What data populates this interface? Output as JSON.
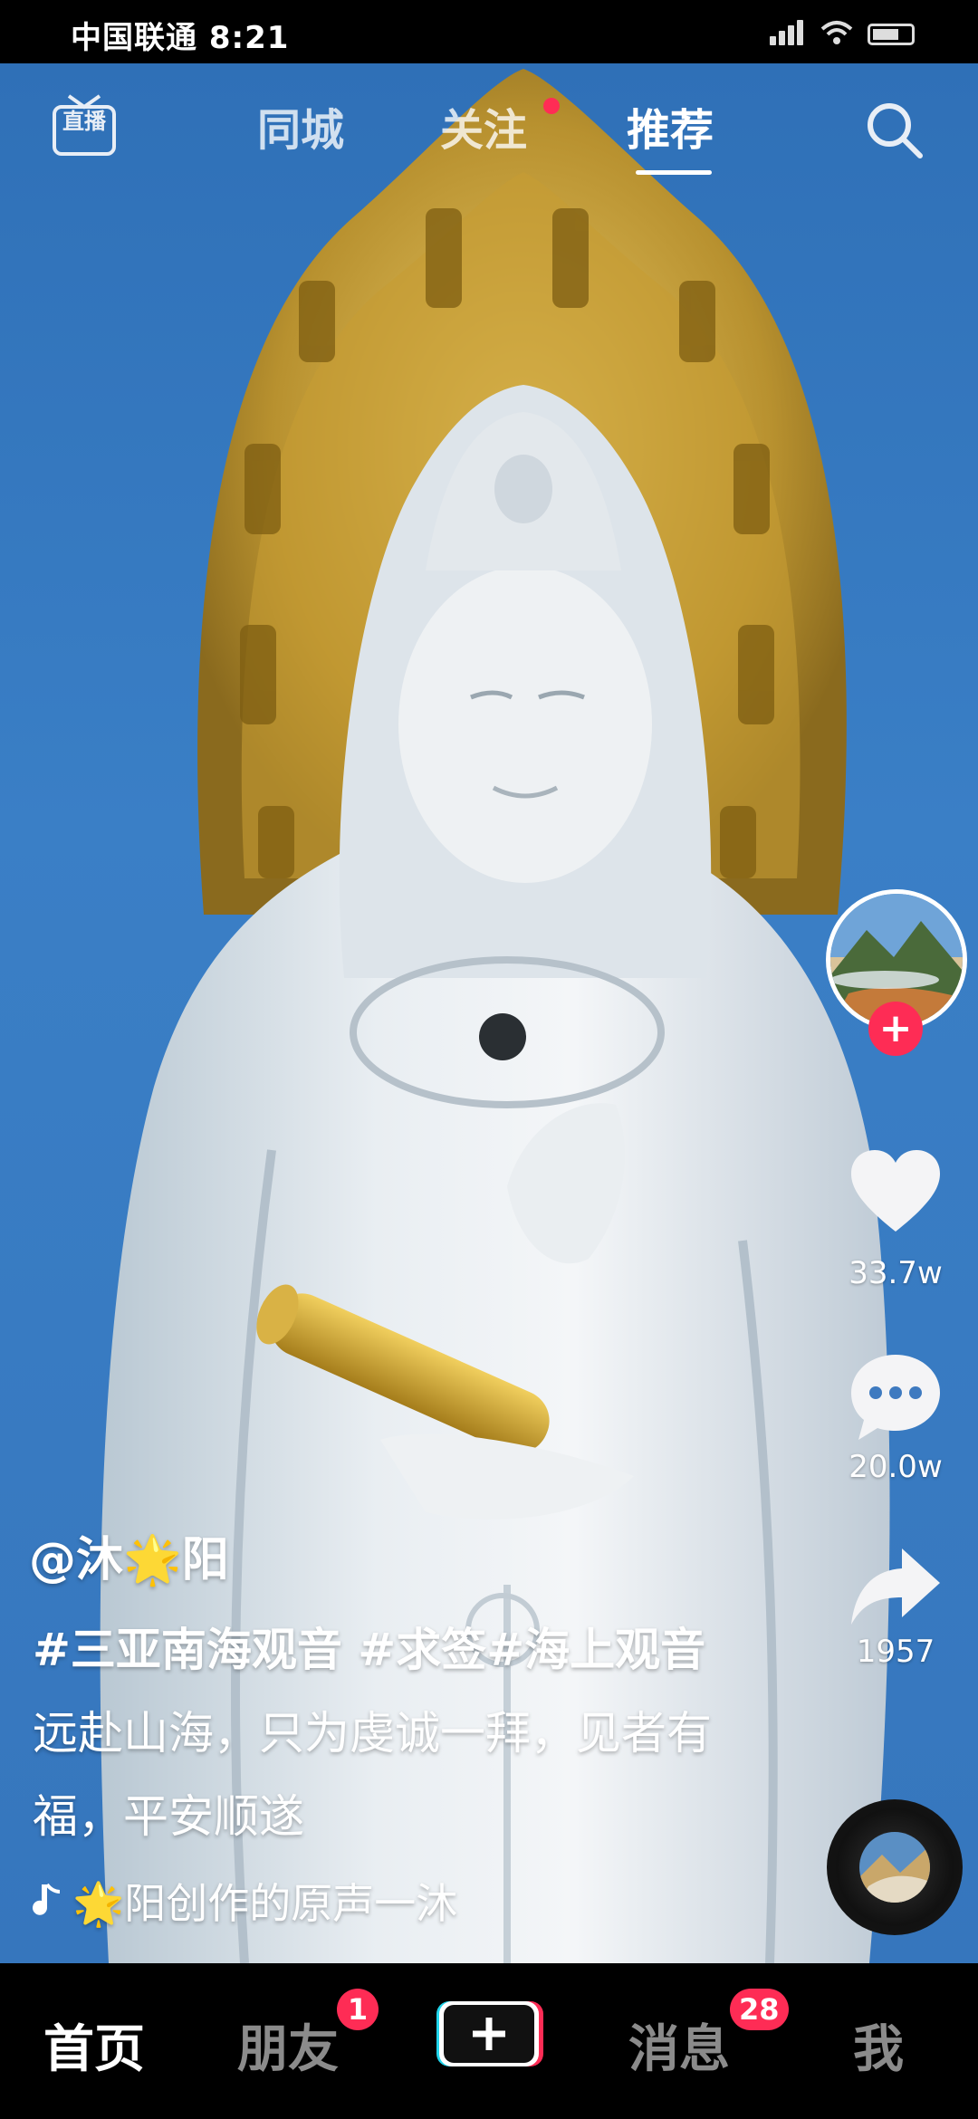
{
  "status_bar": {
    "carrier_time": "中国联通 8:21"
  },
  "top_nav": {
    "live_label_line1": "直",
    "live_label_line2": "播",
    "tabs": [
      {
        "label": "同城"
      },
      {
        "label": "关注"
      },
      {
        "label": "推荐"
      }
    ],
    "active_tab": "推荐"
  },
  "rail": {
    "likes": "33.7w",
    "comments": "20.0w",
    "shares": "1957"
  },
  "post": {
    "author": "@沐🌟阳",
    "hashtags": "#三亚南海观音 #求签#海上观音",
    "text": "远赴山海，只为虔诚一拜，见者有福，平安顺遂",
    "music": "🌟阳创作的原声一沐"
  },
  "bottom_nav": {
    "home": "首页",
    "friends": "朋友",
    "friends_badge": "1",
    "messages": "消息",
    "messages_badge": "28",
    "me": "我"
  },
  "colors": {
    "accent_red": "#fe2c55",
    "sky_blue": "#3a7fc6",
    "halo_gold": "#b8912f"
  }
}
